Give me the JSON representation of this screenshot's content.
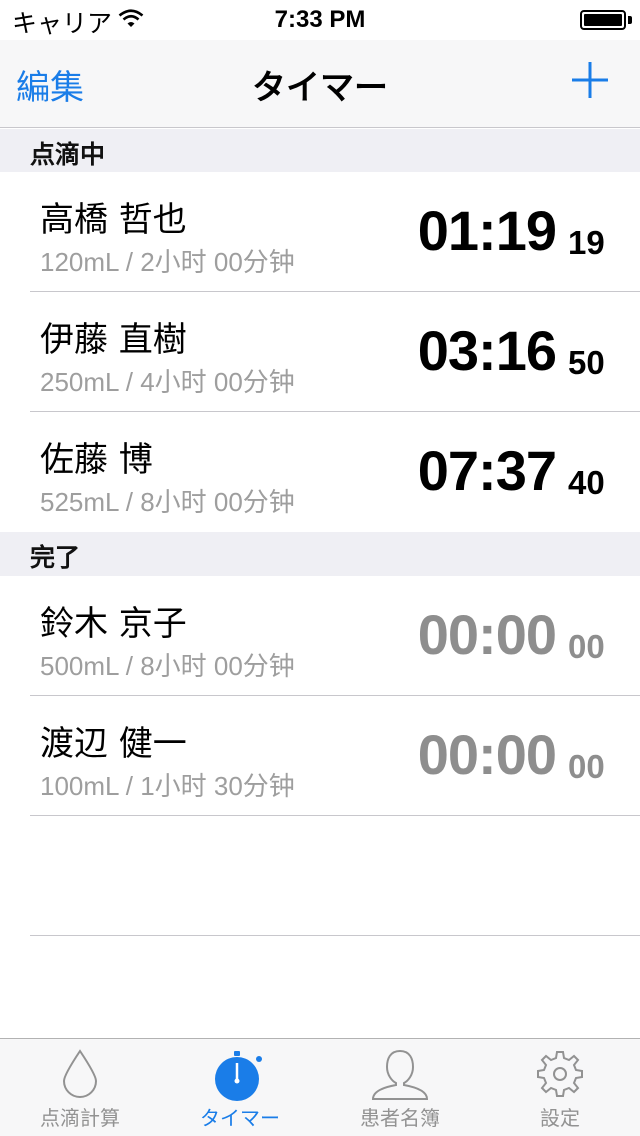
{
  "status_bar": {
    "carrier": "キャリア",
    "time": "7:33 PM"
  },
  "nav": {
    "edit_label": "編集",
    "title": "タイマー",
    "add_icon": "plus-icon"
  },
  "sections": {
    "running": {
      "header": "点滴中",
      "rows": [
        {
          "name": "高橋 哲也",
          "detail": "120mL / 2小时 00分钟",
          "timer": "01:19",
          "seconds": "19"
        },
        {
          "name": "伊藤 直樹",
          "detail": "250mL / 4小时 00分钟",
          "timer": "03:16",
          "seconds": "50"
        },
        {
          "name": "佐藤 博",
          "detail": "525mL / 8小时 00分钟",
          "timer": "07:37",
          "seconds": "40"
        }
      ]
    },
    "done": {
      "header": "完了",
      "rows": [
        {
          "name": "鈴木 京子",
          "detail": "500mL / 8小时 00分钟",
          "timer": "00:00",
          "seconds": "00"
        },
        {
          "name": "渡辺 健一",
          "detail": "100mL / 1小时 30分钟",
          "timer": "00:00",
          "seconds": "00"
        }
      ]
    }
  },
  "tabs": [
    {
      "label": "点滴計算",
      "icon": "drop-icon",
      "active": false
    },
    {
      "label": "タイマー",
      "icon": "stopwatch-icon",
      "active": true
    },
    {
      "label": "患者名簿",
      "icon": "person-icon",
      "active": false
    },
    {
      "label": "設定",
      "icon": "gear-icon",
      "active": false
    }
  ],
  "colors": {
    "accent": "#1a7de8",
    "inactive": "#929292",
    "done_timer": "#8e8e8e",
    "section_bg": "#efeff4"
  }
}
